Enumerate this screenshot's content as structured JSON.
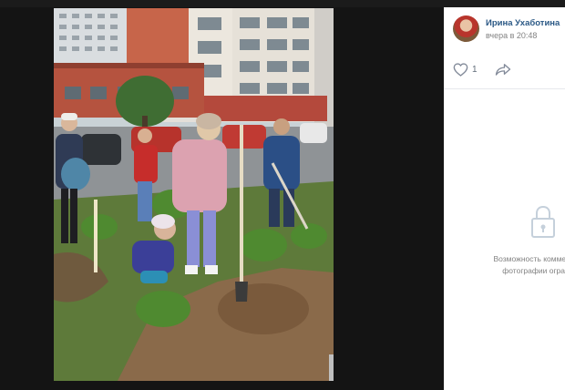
{
  "post": {
    "author_name": "Ирина Ухаботина",
    "time": "вчера в 20:48",
    "likes": "1"
  },
  "comments": {
    "closed_line1": "Возможность комменти",
    "closed_line2": "фотографии огран"
  },
  "icons": {
    "like": "heart-icon",
    "share": "share-arrow-icon",
    "lock": "lock-icon"
  },
  "colors": {
    "link": "#2a5885",
    "muted": "#828282",
    "viewer_bg": "#141414"
  }
}
